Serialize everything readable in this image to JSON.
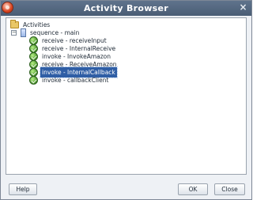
{
  "window": {
    "title": "Activity Browser",
    "icon": "oracle-app-icon"
  },
  "tree": {
    "root_label": "Activities",
    "sequence_label": "sequence - main",
    "items": [
      {
        "label": "receive - receiveInput",
        "icon": "activity-icon"
      },
      {
        "label": "receive - InternalReceive",
        "icon": "activity-icon"
      },
      {
        "label": "invoke - InvokeAmazon",
        "icon": "activity-icon"
      },
      {
        "label": "receive - ReceiveAmazon",
        "icon": "activity-icon"
      },
      {
        "label": "invoke - InternalCallback",
        "icon": "activity-icon",
        "selected": true
      },
      {
        "label": "invoke - callbackClient",
        "icon": "activity-icon"
      }
    ]
  },
  "buttons": {
    "help": "Help",
    "ok": "OK",
    "close": "Close"
  },
  "colors": {
    "titlebar": "#4a5d75",
    "selection": "#2f5ea5"
  }
}
